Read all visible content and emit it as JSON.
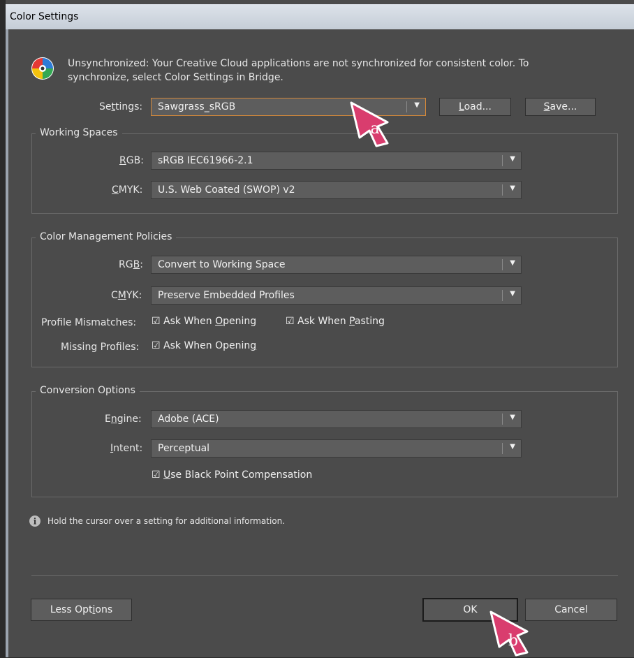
{
  "window": {
    "title": "Color Settings"
  },
  "sync": {
    "line1": "Unsynchronized: Your Creative Cloud applications are not synchronized for consistent color. To",
    "line2": "synchronize, select Color Settings in Bridge."
  },
  "settings": {
    "label": "Settings:",
    "value": "Sawgrass_sRGB",
    "load": "Load...",
    "save": "Save..."
  },
  "working_spaces": {
    "title": "Working Spaces",
    "rgb_label": "RGB:",
    "rgb_value": "sRGB IEC61966-2.1",
    "cmyk_label": "CMYK:",
    "cmyk_value": "U.S. Web Coated (SWOP) v2"
  },
  "policies": {
    "title": "Color Management Policies",
    "rgb_label": "RGB:",
    "rgb_value": "Convert to Working Space",
    "cmyk_label": "CMYK:",
    "cmyk_value": "Preserve Embedded Profiles",
    "mismatch_label": "Profile Mismatches:",
    "ask_opening": "Ask When Opening",
    "ask_pasting": "Ask When Pasting",
    "missing_label": "Missing Profiles:",
    "missing_ask_opening": "Ask When Opening"
  },
  "conversion": {
    "title": "Conversion Options",
    "engine_label": "Engine:",
    "engine_value": "Adobe (ACE)",
    "intent_label": "Intent:",
    "intent_value": "Perceptual",
    "bpc": "Use Black Point Compensation"
  },
  "info": "Hold the cursor over a setting for additional information.",
  "buttons": {
    "less": "Less Options",
    "ok": "OK",
    "cancel": "Cancel"
  },
  "callouts": {
    "a": "a",
    "b": "b"
  },
  "colors": {
    "accent": "#d4893a",
    "callout": "#d93d6e",
    "panel": "#4b4b4b"
  }
}
